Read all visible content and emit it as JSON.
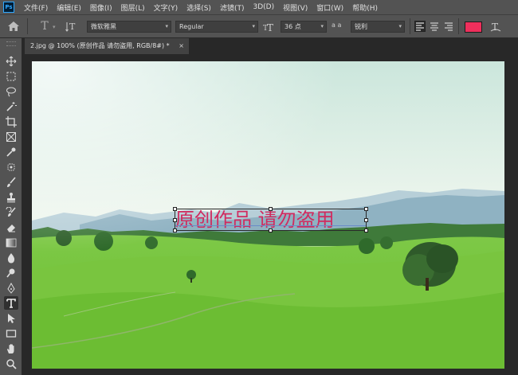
{
  "app": {
    "logo": "Ps"
  },
  "menu": [
    "文件(F)",
    "编辑(E)",
    "图像(I)",
    "图层(L)",
    "文字(Y)",
    "选择(S)",
    "滤镜(T)",
    "3D(D)",
    "视图(V)",
    "窗口(W)",
    "帮助(H)"
  ],
  "options": {
    "tool_glyph": "T",
    "font_family": "微软雅黑",
    "font_style": "Regular",
    "font_size": "36 点",
    "aa_label": "a a",
    "antialias": "锐利",
    "text_color": "#ef2f5c"
  },
  "document": {
    "tab_title": "2.jpg @ 100% (原创作品 请勿盗用, RGB/8#) *",
    "close_glyph": "×"
  },
  "text_layer": {
    "content": "原创作品 请勿盗用",
    "color": "#d12a5f"
  },
  "tools": [
    "move-icon",
    "marquee-icon",
    "lasso-icon",
    "magic-wand-icon",
    "crop-icon",
    "frame-icon",
    "eyedropper-icon",
    "healing-icon",
    "brush-icon",
    "stamp-icon",
    "history-brush-icon",
    "eraser-icon",
    "gradient-icon",
    "blur-icon",
    "dodge-icon",
    "pen-icon",
    "type-icon",
    "path-select-icon",
    "rectangle-icon",
    "hand-icon",
    "zoom-icon"
  ],
  "active_tool": "type-icon"
}
